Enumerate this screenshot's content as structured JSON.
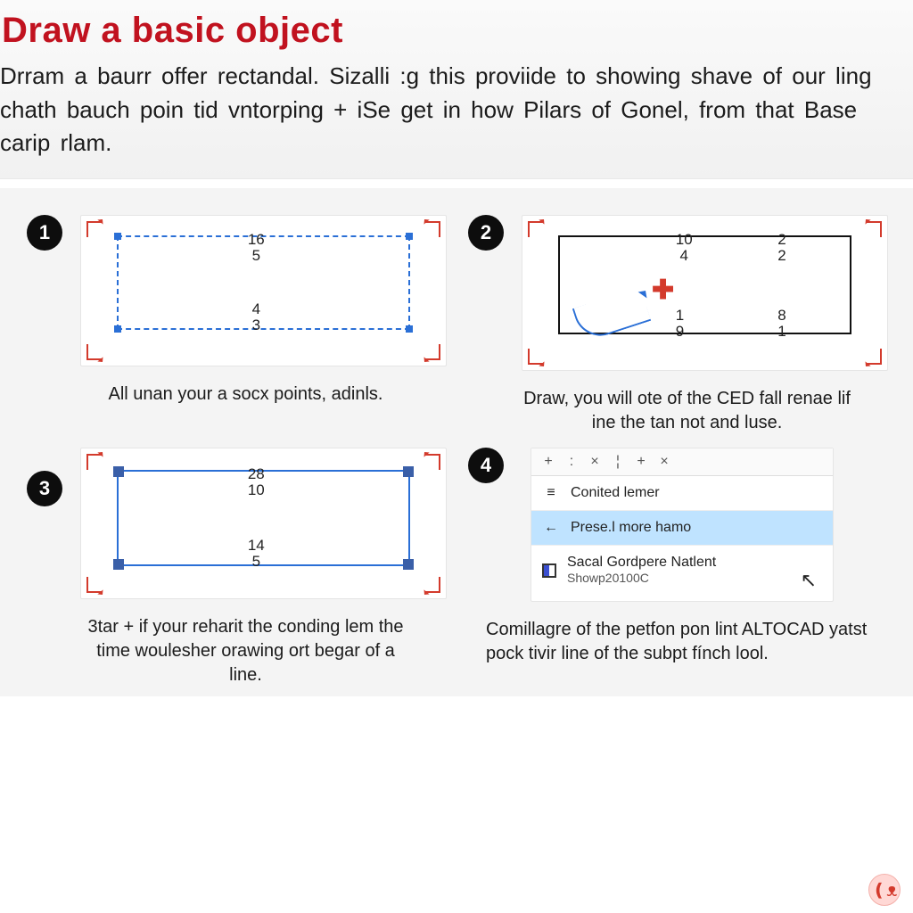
{
  "header": {
    "title": "Draw a basic object",
    "intro": "Drram a baurr offer rectandal. Sizalli :g this proviide to showing shave of our ling chath bauch poin tid vntorping + iSe get in how Pilars of Gonel, from that Base carip rlam."
  },
  "steps": {
    "s1": {
      "num": "1",
      "top_a": "16",
      "top_b": "5",
      "bot_a": "4",
      "bot_b": "3",
      "caption": "All unan your a socx points, adinls."
    },
    "s2": {
      "num": "2",
      "t1a": "10",
      "t1b": "4",
      "t2a": "2",
      "t2b": "2",
      "b1a": "1",
      "b1b": "9",
      "b2a": "8",
      "b2b": "1",
      "caption": "Draw, you will ote of the CED fall renae lif ine the tan not and luse."
    },
    "s3": {
      "num": "3",
      "top_a": "28",
      "top_b": "10",
      "bot_a": "14",
      "bot_b": "5",
      "caption": "3tar + if your reharit the conding lem the time woulesher orawing ort begar of a line."
    },
    "s4": {
      "num": "4",
      "row1": "Conited lemer",
      "row2": "Prese.l more hamo",
      "row3a": "Sacal Gordpere Natlent",
      "row3b": "Showp20100C",
      "caption": "Comillagre of the petfon pon lint ALTOCAD yatst pock tivir line of the subpt fínch lool."
    }
  }
}
